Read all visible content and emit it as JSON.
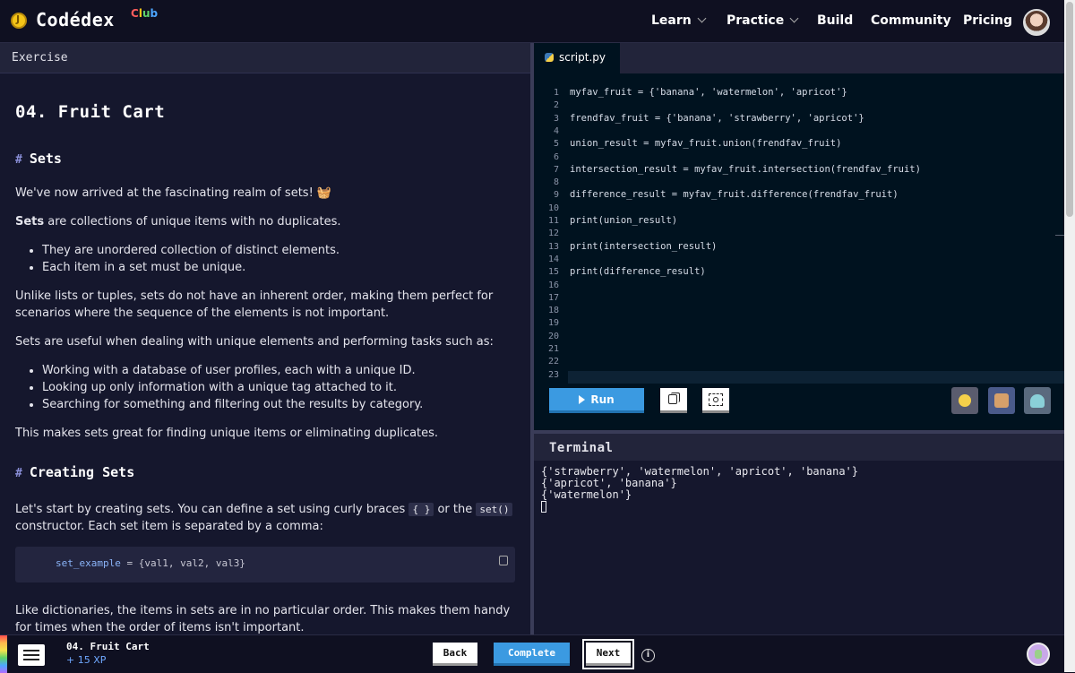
{
  "nav": {
    "brand": "Codédex",
    "brand_letters": [
      "C",
      "l",
      "u",
      "b"
    ],
    "brand_colors": [
      "#ff5c5c",
      "#f5c518",
      "#5ed36a",
      "#4da6ff"
    ],
    "items": [
      {
        "label": "Learn",
        "dropdown": true
      },
      {
        "label": "Practice",
        "dropdown": true
      },
      {
        "label": "Build",
        "dropdown": false
      },
      {
        "label": "Community",
        "dropdown": false
      },
      {
        "label": "Pricing",
        "dropdown": false
      }
    ]
  },
  "lesson": {
    "panel_title": "Exercise",
    "title": "04. Fruit Cart",
    "section1": "Sets",
    "p1": "We've now arrived at the fascinating realm of sets! 🧺",
    "p2_bold": "Sets",
    "p2_rest": " are collections of unique items with no duplicates.",
    "bullets1": [
      "They are unordered collection of distinct elements.",
      "Each item in a set must be unique."
    ],
    "p3": "Unlike lists or tuples, sets do not have an inherent order, making them perfect for scenarios where the sequence of the elements is not important.",
    "p4": "Sets are useful when dealing with unique elements and performing tasks such as:",
    "bullets2": [
      "Working with a database of user profiles, each with a unique ID.",
      "Looking up only information with a unique tag attached to it.",
      "Searching for something and filtering out the results by category."
    ],
    "p5": "This makes sets great for finding unique items or eliminating duplicates.",
    "section2": "Creating Sets",
    "p6_a": "Let's start by creating sets. You can define a set using curly braces ",
    "p6_code1": "{ }",
    "p6_b": " or the ",
    "p6_code2": "set()",
    "p6_c": " constructor. Each set item is separated by a comma:",
    "code_var": "set_example",
    "code_rest": " = {val1, val2, val3}",
    "p7": "Like dictionaries, the items in sets are in no particular order. This makes them handy for times when the order of items isn't important."
  },
  "editor": {
    "filename": "script.py",
    "line_numbers": [
      "1",
      "2",
      "3",
      "4",
      "5",
      "6",
      "7",
      "8",
      "9",
      "10",
      "11",
      "12",
      "13",
      "14",
      "15",
      "16",
      "17",
      "18",
      "19",
      "20",
      "21",
      "22",
      "23"
    ],
    "lines": [
      "myfav_fruit = {'banana', 'watermelon', 'apricot'}",
      "frendfav_fruit = {'banana', 'strawberry', 'apricot'}",
      "union_result = myfav_fruit.union(frendfav_fruit)",
      "intersection_result = myfav_fruit.intersection(frendfav_fruit)",
      "difference_result = myfav_fruit.difference(frendfav_fruit)",
      "print(union_result)",
      "print(intersection_result)",
      "print(difference_result)"
    ],
    "run_label": "Run"
  },
  "terminal": {
    "title": "Terminal",
    "output": [
      "{'strawberry', 'watermelon', 'apricot', 'banana'}",
      "{'apricot', 'banana'}",
      "{'watermelon'}"
    ]
  },
  "footer": {
    "title": "04. Fruit Cart",
    "xp": "+ 15 XP",
    "back": "Back",
    "complete": "Complete",
    "next": "Next",
    "info": "i"
  }
}
